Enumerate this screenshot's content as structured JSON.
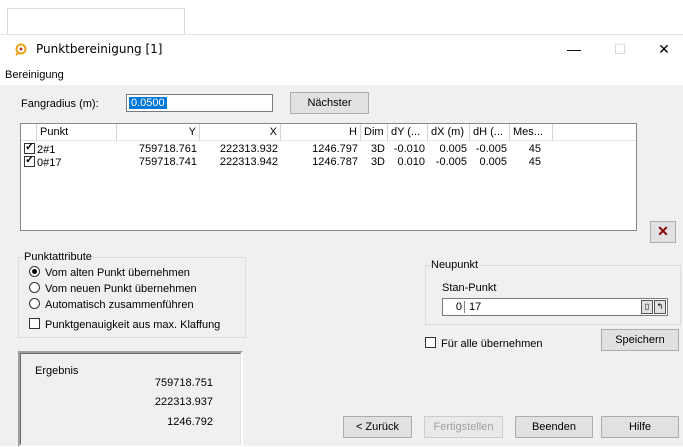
{
  "window": {
    "title": "Punktbereinigung [1]",
    "minimize": "—",
    "maximize": "☐",
    "close": "✕"
  },
  "menu": {
    "item": "Bereinigung"
  },
  "fangradius": {
    "label": "Fangradius (m):",
    "value": "0.0500",
    "next_button": "Nächster"
  },
  "list": {
    "columns": [
      "Punkt",
      "Y",
      "X",
      "H",
      "Dim",
      "dY (...",
      "dX (m)",
      "dH (...",
      "Mes..."
    ],
    "rows": [
      {
        "checked": true,
        "punkt": "2#1",
        "y": "759718.761",
        "x": "222313.932",
        "h": "1246.797",
        "dim": "3D",
        "dy": "-0.010",
        "dx": "0.005",
        "dh": "-0.005",
        "mes": "45"
      },
      {
        "checked": true,
        "punkt": "0#17",
        "y": "759718.741",
        "x": "222313.942",
        "h": "1246.787",
        "dim": "3D",
        "dy": "0.010",
        "dx": "-0.005",
        "dh": "0.005",
        "mes": "45"
      }
    ]
  },
  "punktattribute": {
    "title": "Punktattribute",
    "options": [
      {
        "label": "Vom alten Punkt übernehmen",
        "selected": true
      },
      {
        "label": "Vom neuen Punkt übernehmen",
        "selected": false
      },
      {
        "label": "Automatisch zusammenführen",
        "selected": false
      }
    ],
    "checkbox_label": "Punktgenauigkeit aus max. Klaffung"
  },
  "neupunkt": {
    "title": "Neupunkt",
    "stan_label": "Stan-Punkt",
    "stan_value": "0",
    "punkt_value": "17"
  },
  "fuer_alle": {
    "label": "Für alle übernehmen"
  },
  "buttons": {
    "speichern": "Speichern",
    "zurueck": "< Zurück",
    "fertigstellen": "Fertigstellen",
    "beenden": "Beenden",
    "hilfe": "Hilfe",
    "delete_icon": "✕"
  },
  "ergebnis": {
    "title": "Ergebnis",
    "values": [
      "759718.751",
      "222313.937",
      "1246.792"
    ]
  }
}
